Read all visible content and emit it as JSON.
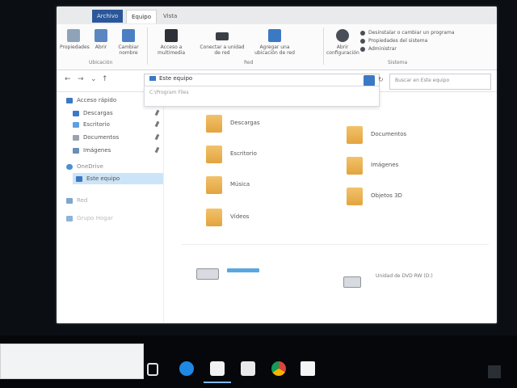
{
  "ribbon": {
    "tabs": [
      "Archivo",
      "Equipo",
      "Vista"
    ],
    "buttons": [
      {
        "label": "Propiedades",
        "icon": "properties-icon"
      },
      {
        "label": "Abrir",
        "icon": "open-icon"
      },
      {
        "label": "Cambiar nombre",
        "icon": "rename-icon"
      },
      {
        "label": "Acceso a multimedia",
        "icon": "media-icon"
      },
      {
        "label": "Conectar a unidad de red",
        "icon": "network-drive-icon"
      },
      {
        "label": "Agregar una ubicación de red",
        "icon": "network-location-icon"
      },
      {
        "label": "Abrir configuración",
        "icon": "settings-icon"
      }
    ],
    "groups": [
      "Ubicación",
      "Red",
      "Sistema"
    ],
    "system_items": [
      "Desinstalar o cambiar un programa",
      "Propiedades del sistema",
      "Administrar"
    ]
  },
  "address": {
    "current": "Este equipo",
    "suggestion": "C:\\Program Files",
    "search_placeholder": "Buscar en Este equipo"
  },
  "nav": {
    "quick_access": "Acceso rápido",
    "items": [
      {
        "label": "Descargas"
      },
      {
        "label": "Escritorio"
      },
      {
        "label": "Documentos"
      },
      {
        "label": "Imágenes"
      }
    ],
    "onedrive": "OneDrive",
    "this_pc": "Este equipo",
    "network": "Red",
    "homegroup": "Grupo Hogar"
  },
  "folders": {
    "left": [
      "Descargas",
      "Escritorio",
      "Música",
      "Vídeos"
    ],
    "right": [
      "Documentos",
      "Imágenes",
      "Objetos 3D"
    ]
  },
  "devices": {
    "dvd": "Unidad de DVD RW (D:)"
  },
  "colors": {
    "accent": "#3c79c4",
    "folder": "#e3a43f",
    "selection": "#cce4f7"
  }
}
